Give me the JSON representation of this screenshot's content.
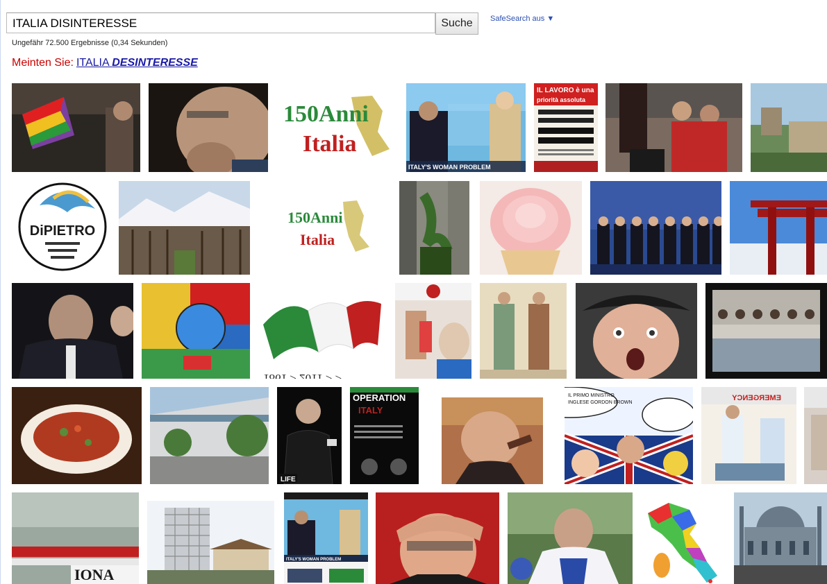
{
  "search": {
    "query": "ITALIA DISINTERESSE",
    "button_label": "Suche",
    "safesearch_label": "SafeSearch aus ▼"
  },
  "results": {
    "stats": "Ungefähr 72.500 Ergebnisse (0,34 Sekunden)"
  },
  "suggestion": {
    "prefix": "Meinten Sie:",
    "term_regular": "ITALIA ",
    "term_bold": "DESINTERESSE"
  },
  "images": [
    {
      "name": "pride-flag-photo-thumbnail",
      "text": ""
    },
    {
      "name": "elderly-man-thinking-thumbnail",
      "text": ""
    },
    {
      "name": "150-anni-italia-logo-thumbnail",
      "text": "150Anni Italia"
    },
    {
      "name": "italys-woman-problem-thumbnail",
      "text": "ITALY'S WOMAN PROBLEM"
    },
    {
      "name": "il-lavoro-poster-thumbnail",
      "text": "IL LAVORO è una priorità assoluta"
    },
    {
      "name": "press-photographers-thumbnail",
      "text": ""
    },
    {
      "name": "coastal-ruins-thumbnail",
      "text": ""
    },
    {
      "name": "dipietro-logo-thumbnail",
      "text": "DiPIETRO"
    },
    {
      "name": "orchard-mountains-thumbnail",
      "text": ""
    },
    {
      "name": "150-anni-italia-small-logo-thumbnail",
      "text": "150Anni Italia"
    },
    {
      "name": "plant-wall-thumbnail",
      "text": ""
    },
    {
      "name": "pink-cupcake-thumbnail",
      "text": ""
    },
    {
      "name": "group-of-leaders-thumbnail",
      "text": ""
    },
    {
      "name": "red-torii-gate-thumbnail",
      "text": ""
    },
    {
      "name": "politician-crowd-thumbnail",
      "text": ""
    },
    {
      "name": "colorful-painting-thumbnail",
      "text": ""
    },
    {
      "name": "italian-flag-1861-2011-thumbnail",
      "text": "1861 > 2011 > >"
    },
    {
      "name": "vaccine-vial-thumbnail",
      "text": ""
    },
    {
      "name": "medieval-figures-thumbnail",
      "text": ""
    },
    {
      "name": "surprised-man-beret-thumbnail",
      "text": ""
    },
    {
      "name": "migrants-boat-thumbnail",
      "text": ""
    },
    {
      "name": "pasta-dish-thumbnail",
      "text": ""
    },
    {
      "name": "alfa-romeo-building-thumbnail",
      "text": ""
    },
    {
      "name": "man-on-stage-thumbnail",
      "text": "LIFE"
    },
    {
      "name": "operation-italy-poster-thumbnail",
      "text": "OPERATION ITALY"
    },
    {
      "name": "caricature-judge-thumbnail",
      "text": ""
    },
    {
      "name": "comic-strip-thumbnail",
      "text": "IL PRIMO MINISTRO INGLESE GORDON BROWN HA NOMINATO COME PORTAVOCE SUA MOGLIE!"
    },
    {
      "name": "emergency-room-thumbnail",
      "text": "EMERGENCY"
    },
    {
      "name": "edge-cropped-thumbnail",
      "text": ""
    },
    {
      "name": "stadium-crowd-thumbnail",
      "text": "IONA"
    },
    {
      "name": "scaffolded-building-thumbnail",
      "text": ""
    },
    {
      "name": "news-page-screenshot-thumbnail",
      "text": "ITALY'S WOMAN PROBLEM"
    },
    {
      "name": "man-shielding-eyes-thumbnail",
      "text": ""
    },
    {
      "name": "fencer-athlete-thumbnail",
      "text": ""
    },
    {
      "name": "colored-italy-map-thumbnail",
      "text": ""
    },
    {
      "name": "blue-mosque-thumbnail",
      "text": ""
    }
  ]
}
